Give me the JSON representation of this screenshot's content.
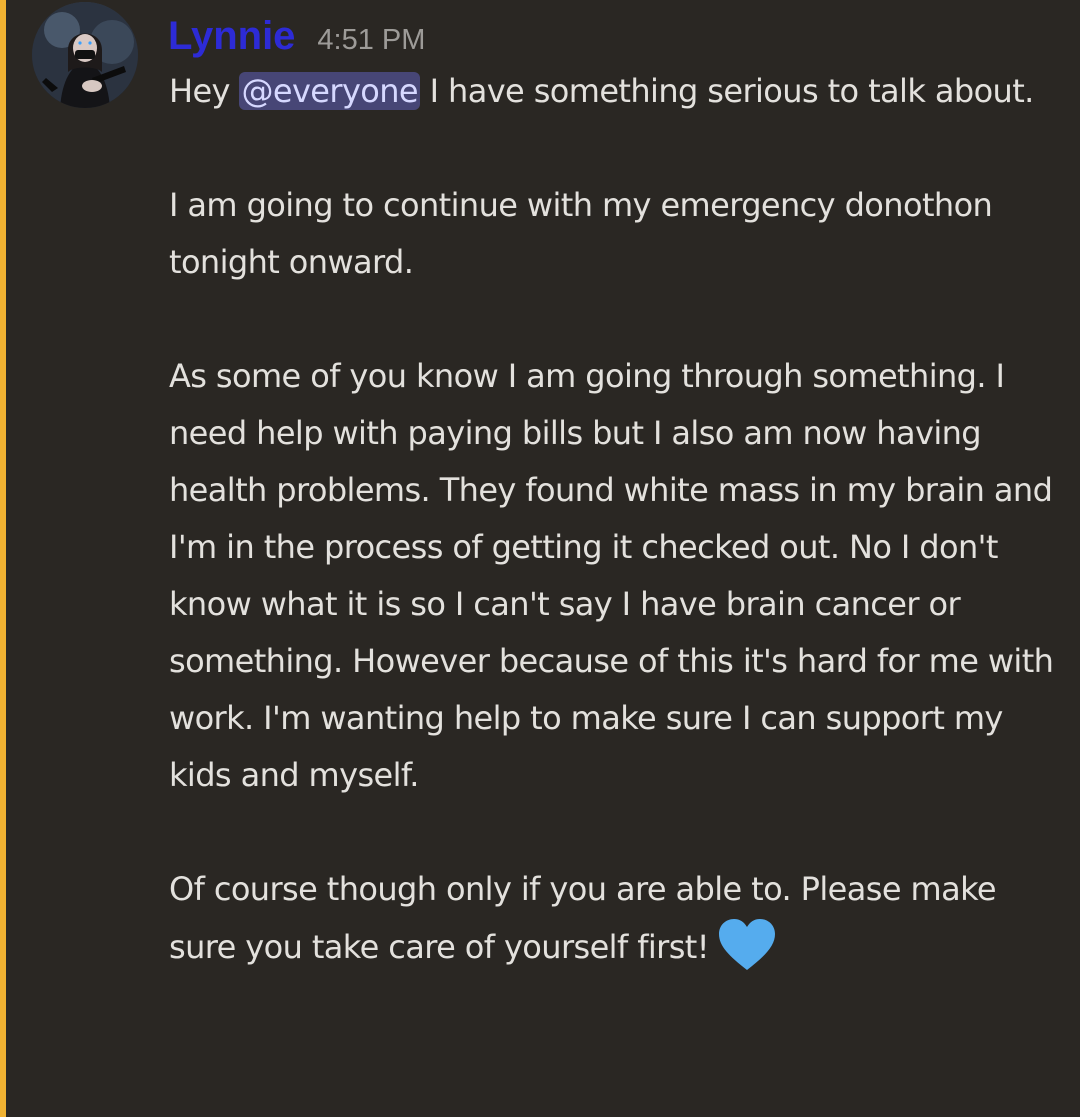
{
  "message": {
    "author": "Lynnie",
    "timestamp": "4:51 PM",
    "author_color": "#2d2bd6",
    "mention_bar_color": "#f0b232",
    "p1_before": "Hey ",
    "p1_mention": "@everyone",
    "p1_after": " I have something serious to talk about.",
    "p2": "I am going to continue with my emergency donothon tonight onward.",
    "p3": "As some of you know I am going through something. I need help with paying bills but I also am now having health problems. They found white mass in my brain and I'm in the process of getting it checked out. No I don't know what it is so I can't say I have brain cancer or something. However because of this it's hard for me with work. I'm wanting help to make sure I can support my kids and myself.",
    "p4": "Of course though only if you are able to. Please make sure you take care of yourself first!",
    "emoji": "blue-heart-icon"
  }
}
